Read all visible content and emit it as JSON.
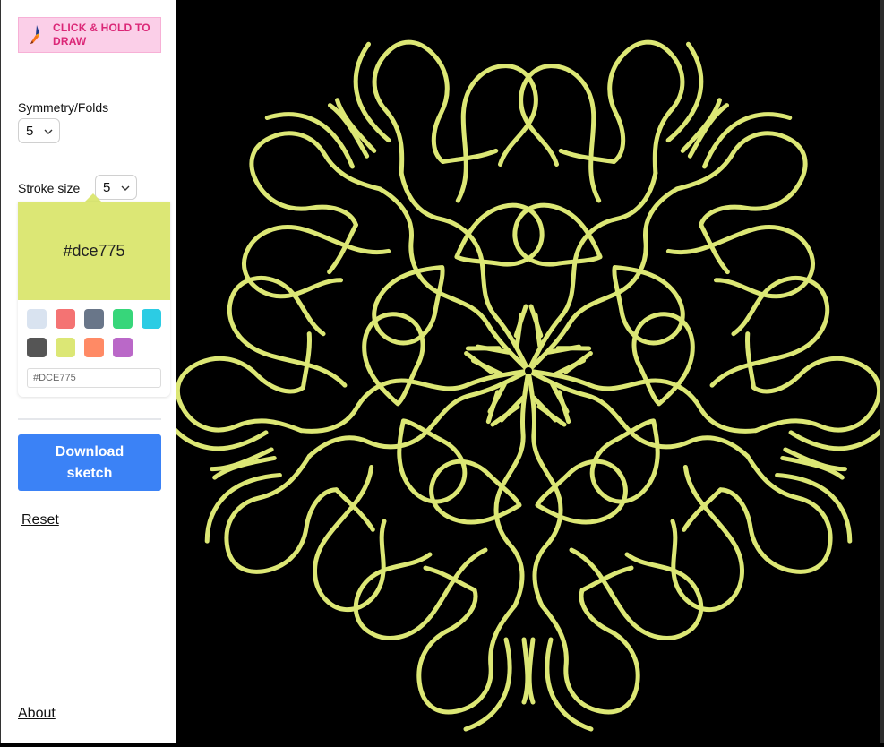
{
  "hint": {
    "text": "CLICK & HOLD TO DRAW",
    "icon": "brush-icon"
  },
  "symmetry": {
    "label": "Symmetry/Folds",
    "value": "5"
  },
  "stroke": {
    "label": "Stroke size",
    "value": "5"
  },
  "color": {
    "current": "#dce775",
    "current_label": "#dce775",
    "hex_input_value": "#DCE775",
    "swatches": [
      "#d9e3f0",
      "#f47373",
      "#697689",
      "#37d67a",
      "#2ccce4",
      "#555555",
      "#dce775",
      "#ff8a65",
      "#ba68c8"
    ]
  },
  "download": {
    "label": "Download sketch"
  },
  "reset": {
    "label": "Reset"
  },
  "about": {
    "label": "About"
  },
  "canvas": {
    "background": "#000000",
    "stroke_color": "#dce775",
    "folds": 5
  }
}
